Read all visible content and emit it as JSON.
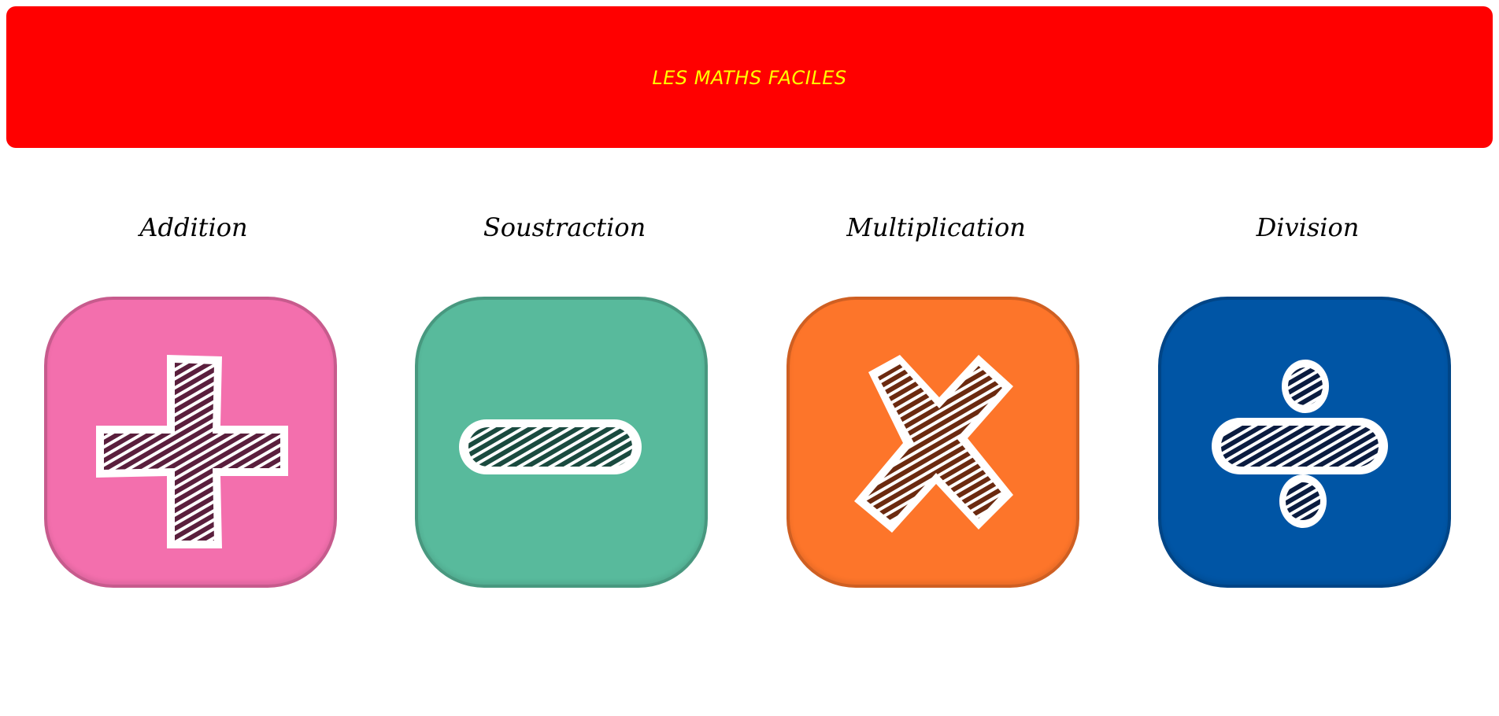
{
  "header": {
    "title": "LES MATHS FACILES",
    "background": "#ff0000",
    "title_color": "#ffff00"
  },
  "operations": [
    {
      "label": "Addition",
      "icon": "plus-icon",
      "color": "#f36fad",
      "hatch": "#5a1f3d"
    },
    {
      "label": "Soustraction",
      "icon": "minus-icon",
      "color": "#58ba9c",
      "hatch": "#1a4a3f"
    },
    {
      "label": "Multiplication",
      "icon": "times-icon",
      "color": "#fd752a",
      "hatch": "#6b2a10"
    },
    {
      "label": "Division",
      "icon": "divide-icon",
      "color": "#0055a5",
      "hatch": "#0b1c40"
    }
  ]
}
